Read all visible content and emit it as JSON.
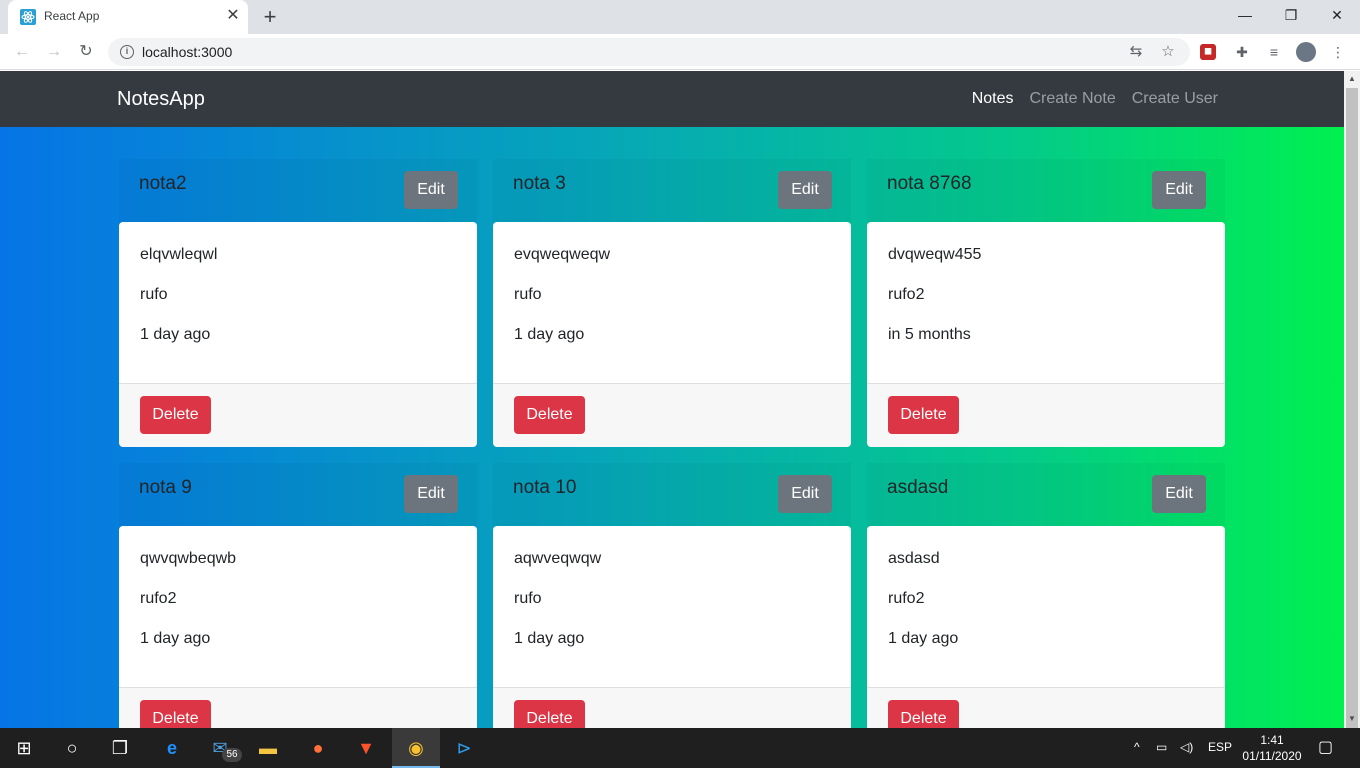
{
  "browser": {
    "tab_title": "React App",
    "tab_close": "✕",
    "new_tab": "+",
    "url": "localhost:3000",
    "window": {
      "minimize": "—",
      "maximize": "❐",
      "close": "✕"
    }
  },
  "navbar": {
    "brand": "NotesApp",
    "links": [
      "Notes",
      "Create Note",
      "Create User"
    ]
  },
  "buttons": {
    "edit": "Edit",
    "delete": "Delete"
  },
  "notes": [
    {
      "title": "nota2",
      "content": "elqvwleqwl",
      "author": "rufo",
      "date": "1 day ago"
    },
    {
      "title": "nota 3",
      "content": "evqweqweqw",
      "author": "rufo",
      "date": "1 day ago"
    },
    {
      "title": "nota 8768",
      "content": "dvqweqw455",
      "author": "rufo2",
      "date": "in 5 months"
    },
    {
      "title": "nota 9",
      "content": "qwvqwbeqwb",
      "author": "rufo2",
      "date": "1 day ago"
    },
    {
      "title": "nota 10",
      "content": "aqwveqwqw",
      "author": "rufo",
      "date": "1 day ago"
    },
    {
      "title": "asdasd",
      "content": "asdasd",
      "author": "rufo2",
      "date": "1 day ago"
    }
  ],
  "taskbar": {
    "mail_badge": "56",
    "language": "ESP",
    "time": "1:41",
    "date": "01/11/2020"
  },
  "colors": {
    "navbar": "#343a40",
    "edit_button": "#6c757d",
    "delete_button": "#dc3545",
    "gradient_start": "#0674e6",
    "gradient_end": "#00f04f"
  }
}
